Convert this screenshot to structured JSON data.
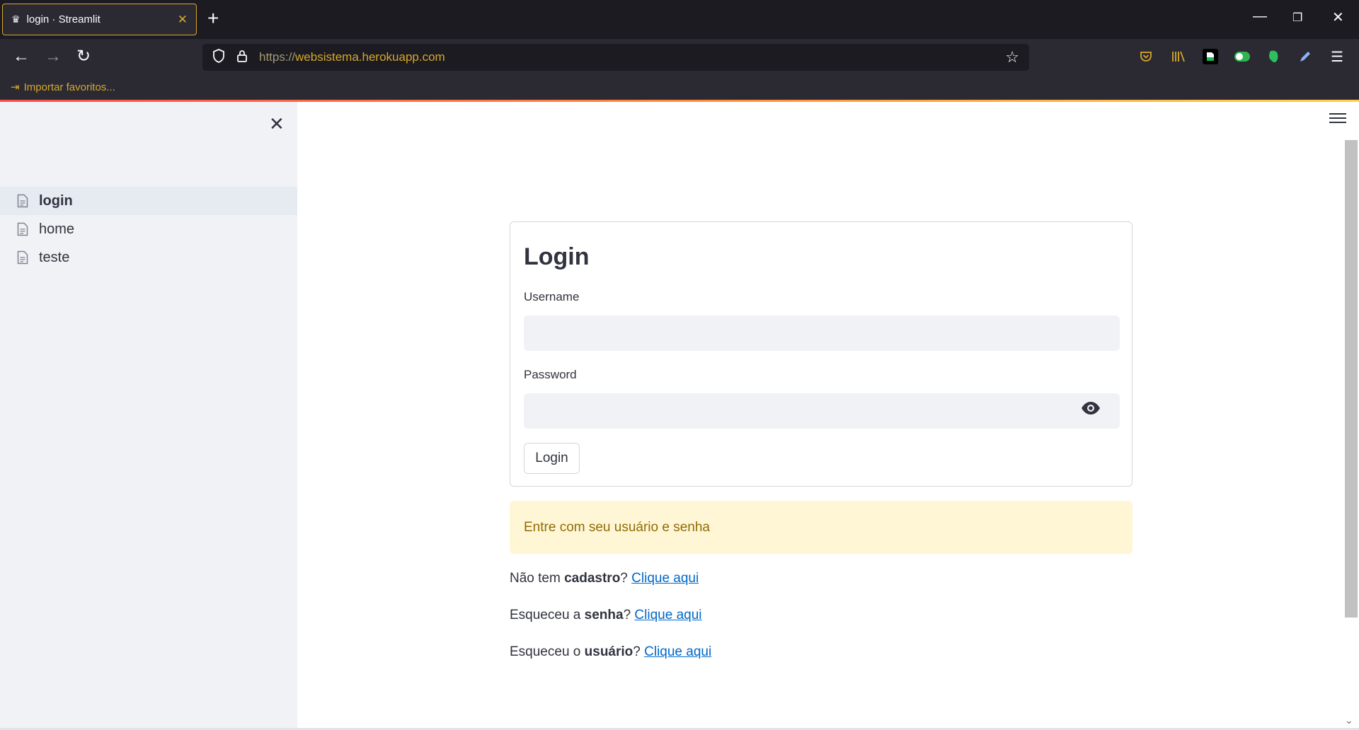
{
  "browser": {
    "tab_title": "login · Streamlit",
    "tab_favicon": "crown-icon",
    "new_tab": "+",
    "url_protocol": "https://",
    "url_host": "websistema.herokuapp.com",
    "bookmark_label": "Importar favoritos...",
    "accent_color": "#d7a82a"
  },
  "sidebar": {
    "items": [
      {
        "label": "login",
        "active": true
      },
      {
        "label": "home",
        "active": false
      },
      {
        "label": "teste",
        "active": false
      }
    ]
  },
  "form": {
    "title": "Login",
    "username_label": "Username",
    "username_value": "",
    "password_label": "Password",
    "password_value": "",
    "submit_label": "Login"
  },
  "alert": {
    "message": "Entre com seu usuário e senha"
  },
  "links": [
    {
      "prefix": "Não tem ",
      "bold": "cadastro",
      "suffix": "? ",
      "link": "Clique aqui"
    },
    {
      "prefix": "Esqueceu a ",
      "bold": "senha",
      "suffix": "? ",
      "link": "Clique aqui"
    },
    {
      "prefix": "Esqueceu o ",
      "bold": "usuário",
      "suffix": "? ",
      "link": "Clique aqui"
    }
  ]
}
